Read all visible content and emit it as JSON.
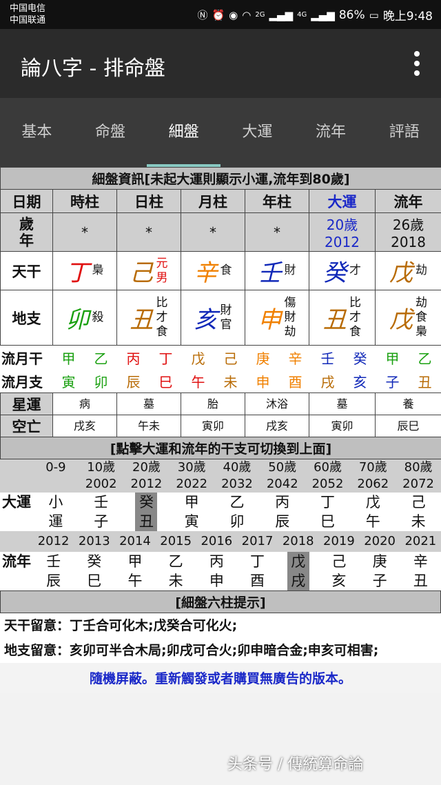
{
  "status_bar": {
    "carrier1": "中国电信",
    "carrier2": "中国联通",
    "battery": "86%",
    "time": "晚上9:48",
    "signal1": "2G",
    "signal2": "4G"
  },
  "app_bar": {
    "title": "論八字 - 排命盤"
  },
  "tabs": [
    "基本",
    "命盤",
    "細盤",
    "大運",
    "流年",
    "評語"
  ],
  "detail": {
    "title": "細盤資訊[未起大運則顯示小運,流年到80歲]",
    "headers": [
      "日期",
      "時柱",
      "日柱",
      "月柱",
      "年柱",
      "大運",
      "流年"
    ],
    "age_label": "歲年",
    "ages": [
      "*",
      "*",
      "*",
      "*"
    ],
    "dayun_age": "20歲",
    "dayun_year": "2012",
    "liunian_age": "26歲",
    "liunian_year": "2018",
    "tiangan_label": "天干",
    "tiangan": [
      {
        "char": "丁",
        "tag": "梟"
      },
      {
        "char": "己",
        "tag": "元男"
      },
      {
        "char": "辛",
        "tag": "食"
      },
      {
        "char": "壬",
        "tag": "財"
      },
      {
        "char": "癸",
        "tag": "才"
      },
      {
        "char": "戊",
        "tag": "劫"
      }
    ],
    "dizhi_label": "地支",
    "dizhi": [
      {
        "char": "卯",
        "tags": [
          "殺"
        ]
      },
      {
        "char": "丑",
        "tags": [
          "比",
          "才",
          "食"
        ]
      },
      {
        "char": "亥",
        "tags": [
          "財",
          "官"
        ]
      },
      {
        "char": "申",
        "tags": [
          "傷",
          "財",
          "劫"
        ]
      },
      {
        "char": "丑",
        "tags": [
          "比",
          "才",
          "食"
        ]
      },
      {
        "char": "戊",
        "tags": [
          "劫",
          "食",
          "梟"
        ]
      }
    ],
    "month_gan_label": "流月干",
    "month_gan": [
      "甲",
      "乙",
      "丙",
      "丁",
      "戊",
      "己",
      "庚",
      "辛",
      "壬",
      "癸",
      "甲",
      "乙"
    ],
    "month_zhi_label": "流月支",
    "month_zhi": [
      "寅",
      "卯",
      "辰",
      "巳",
      "午",
      "未",
      "申",
      "酉",
      "戌",
      "亥",
      "子",
      "丑"
    ],
    "xingyun_label": "星運",
    "xingyun": [
      "病",
      "墓",
      "胎",
      "沐浴",
      "墓",
      "養"
    ],
    "kongwang_label": "空亡",
    "kongwang": [
      "戌亥",
      "午未",
      "寅卯",
      "戌亥",
      "寅卯",
      "辰巳"
    ]
  },
  "switch": {
    "title": "[點擊大運和流年的干支可切換到上面]",
    "dayun_label": "大運",
    "dayun_ages": [
      "0-9",
      "10歲",
      "20歲",
      "30歲",
      "40歲",
      "50歲",
      "60歲",
      "70歲",
      "80歲"
    ],
    "dayun_years": [
      "",
      "2002",
      "2012",
      "2022",
      "2032",
      "2042",
      "2052",
      "2062",
      "2072"
    ],
    "dayun_gan": [
      "小",
      "壬",
      "癸",
      "甲",
      "乙",
      "丙",
      "丁",
      "戊",
      "己"
    ],
    "dayun_zhi": [
      "運",
      "子",
      "丑",
      "寅",
      "卯",
      "辰",
      "巳",
      "午",
      "未"
    ],
    "liunian_label": "流年",
    "liunian_years": [
      "2012",
      "2013",
      "2014",
      "2015",
      "2016",
      "2017",
      "2018",
      "2019",
      "2020",
      "2021"
    ],
    "liunian_gan": [
      "壬",
      "癸",
      "甲",
      "乙",
      "丙",
      "丁",
      "戊",
      "己",
      "庚",
      "辛"
    ],
    "liunian_zhi": [
      "辰",
      "巳",
      "午",
      "未",
      "申",
      "酉",
      "戌",
      "亥",
      "子",
      "丑"
    ]
  },
  "tips": {
    "title": "[細盤六柱提示]",
    "tiangan": "天干留意：丁壬合可化木;戊癸合可化火;",
    "dizhi": "地支留意：亥卯可半合木局;卯戌可合火;卯申暗合金;申亥可相害;"
  },
  "notice": "隨機屏蔽。重新觸發或者購買無廣告的版本。",
  "watermark": "头条号 / 傳統算命論"
}
